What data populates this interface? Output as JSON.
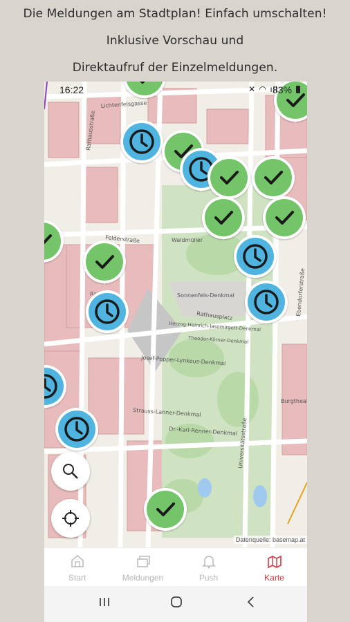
{
  "promo": {
    "line1": "Die Meldungen am Stadtplan! Einfach umschalten!",
    "line2": "Inklusive Vorschau und",
    "line3": "Direktaufruf der Einzelmeldungen."
  },
  "status": {
    "time": "16:22",
    "battery": "83%"
  },
  "map": {
    "street_labels": [
      "Lichtenfelsgasse",
      "Rathausstraße",
      "Felderstraße",
      "Rathausplatz",
      "Universitätsstraße"
    ],
    "place_labels": [
      "Rathaus",
      "Sonnenfels-Denkmal",
      "Herzog-Heinrich-Jasomirgott-Denkmal",
      "Theodor-Körner-Denkmal",
      "Josef-Popper-Lynkeus-Denkmal",
      "Strauss-Lanner-Denkmal",
      "Dr.-Karl-Renner-Denkmal",
      "Waldmüller",
      "Burgtheater",
      "Ebendorferstraße"
    ],
    "attribution": "Datenquelle: basemap.at"
  },
  "pins": [
    {
      "kind": "green",
      "icon": "check"
    },
    {
      "kind": "green",
      "icon": "check"
    },
    {
      "kind": "blue",
      "icon": "clock"
    },
    {
      "kind": "green",
      "icon": "check"
    },
    {
      "kind": "blue",
      "icon": "clock"
    },
    {
      "kind": "green",
      "icon": "check"
    },
    {
      "kind": "green",
      "icon": "check"
    },
    {
      "kind": "green",
      "icon": "check"
    },
    {
      "kind": "green",
      "icon": "check"
    },
    {
      "kind": "green",
      "icon": "check"
    },
    {
      "kind": "blue",
      "icon": "clock"
    },
    {
      "kind": "green",
      "icon": "check"
    },
    {
      "kind": "blue",
      "icon": "clock"
    },
    {
      "kind": "blue",
      "icon": "clock"
    },
    {
      "kind": "blue",
      "icon": "clock"
    },
    {
      "kind": "blue",
      "icon": "clock"
    },
    {
      "kind": "green",
      "icon": "check"
    }
  ],
  "controls": {
    "search_icon": "search-icon",
    "locate_icon": "crosshair-icon"
  },
  "tabs": [
    {
      "label": "Start",
      "icon": "home-icon",
      "active": false
    },
    {
      "label": "Meldungen",
      "icon": "cards-icon",
      "active": false
    },
    {
      "label": "Push",
      "icon": "bell-icon",
      "active": false
    },
    {
      "label": "Karte",
      "icon": "map-icon",
      "active": true
    }
  ],
  "colors": {
    "accent": "#d9343f",
    "pin_green": "#74c46a",
    "pin_blue": "#4fb4e0"
  }
}
